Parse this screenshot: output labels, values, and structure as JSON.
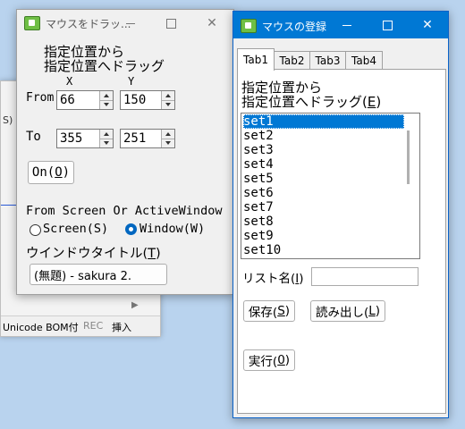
{
  "background_window": {
    "partial_tab": "S)",
    "status": {
      "encoding": "Unicode BOM付",
      "rec": "REC",
      "insert": "挿入"
    }
  },
  "drag_window": {
    "title": "マウスをドラッ...",
    "heading_line1": "指定位置から",
    "heading_line2": "指定位置へドラッグ",
    "col_x": "X",
    "col_y": "Y",
    "from_label": "From",
    "to_label": "To",
    "from_x": "66",
    "from_y": "150",
    "to_x": "355",
    "to_y": "251",
    "on_button": "On(",
    "on_key": "O",
    "on_close": ")",
    "mode_label": "From Screen Or ActiveWindow",
    "radio_screen": "Screen(S)",
    "radio_window": "Window(W)",
    "window_title_label": "ウインドウタイトル(",
    "window_title_key": "T",
    "window_title_close": ")",
    "window_title_value": "(無題) - sakura 2."
  },
  "register_window": {
    "title": "マウスの登録",
    "tabs": [
      "Tab1",
      "Tab2",
      "Tab3",
      "Tab4"
    ],
    "heading_line1": "指定位置から",
    "heading_line2": "指定位置へドラッグ(",
    "heading_key": "E",
    "heading_close": ")",
    "list_items": [
      "set1",
      "set2",
      "set3",
      "set4",
      "set5",
      "set6",
      "set7",
      "set8",
      "set9",
      "set10"
    ],
    "selected_item": "set1",
    "list_name_label": "リスト名(",
    "list_name_key": "I",
    "list_name_close": ")",
    "list_name_value": "",
    "save_button": "保存(",
    "save_key": "S",
    "load_button": "読み出し(",
    "load_key": "L",
    "run_button": "実行(",
    "run_key": "0",
    "close_paren": ")"
  },
  "colors": {
    "accent": "#0078d4",
    "icon_green": "#6fbf45",
    "desktop": "#b9d3ee"
  }
}
